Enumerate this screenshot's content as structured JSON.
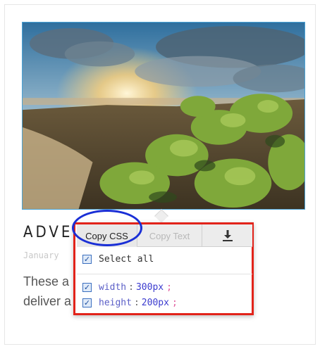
{
  "article": {
    "heading": "ADVEN",
    "date": "January",
    "excerpt": "These a\ndeliver a"
  },
  "popover": {
    "toolbar": {
      "copy_css_label": "Copy CSS",
      "copy_text_label": "Copy Text",
      "download_icon": "download-icon"
    },
    "select_all": {
      "label": "Select all",
      "checked": true
    },
    "properties": [
      {
        "name": "width",
        "value": "300px",
        "checked": true
      },
      {
        "name": "height",
        "value": "200px",
        "checked": true
      }
    ]
  },
  "colors": {
    "highlight_border": "#e2231a",
    "oval_highlight": "#1a2fd6",
    "photo_border": "#4aa3d6",
    "property_name": "#5b5fc7",
    "property_value": "#3c3ccf",
    "semicolon": "#e05a9c"
  }
}
